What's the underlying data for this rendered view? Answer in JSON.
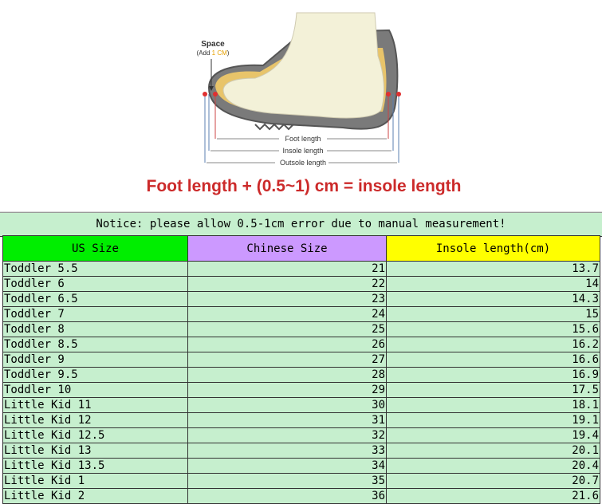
{
  "figure": {
    "space_label": "Space",
    "space_note_prefix": "(Add ",
    "space_note_value": "1 CM",
    "space_note_suffix": ")",
    "measure_labels": [
      "Foot length",
      "Insole length",
      "Outsole length"
    ],
    "formula": "Foot length + (0.5~1) cm = insole length",
    "colors": {
      "formula": "#cc2a2a",
      "space_note_value": "#e6a000",
      "marker": "#e03030",
      "foot": "#f3f1d8",
      "insole": "#e8c46a",
      "shoe": "#777777"
    }
  },
  "notice": "Notice: please allow 0.5-1cm error due to manual measurement!",
  "table": {
    "headers": [
      "US Size",
      "Chinese Size",
      "Insole length(cm)"
    ],
    "header_colors": [
      "#00ee00",
      "#cc99ff",
      "#ffff00"
    ],
    "row_color": "#c6efce",
    "rows": [
      [
        "Toddler 5.5",
        "21",
        "13.7"
      ],
      [
        "Toddler 6",
        "22",
        "14"
      ],
      [
        "Toddler 6.5",
        "23",
        "14.3"
      ],
      [
        "Toddler 7",
        "24",
        "15"
      ],
      [
        "Toddler 8",
        "25",
        "15.6"
      ],
      [
        "Toddler 8.5",
        "26",
        "16.2"
      ],
      [
        "Toddler 9",
        "27",
        "16.6"
      ],
      [
        "Toddler 9.5",
        "28",
        "16.9"
      ],
      [
        "Toddler 10",
        "29",
        "17.5"
      ],
      [
        "Little Kid 11",
        "30",
        "18.1"
      ],
      [
        "Little Kid 12",
        "31",
        "19.1"
      ],
      [
        "Little Kid 12.5",
        "32",
        "19.4"
      ],
      [
        "Little Kid 13",
        "33",
        "20.1"
      ],
      [
        "Little Kid 13.5",
        "34",
        "20.4"
      ],
      [
        "Little Kid 1",
        "35",
        "20.7"
      ],
      [
        "Little Kid 2",
        "36",
        "21.6"
      ]
    ]
  }
}
